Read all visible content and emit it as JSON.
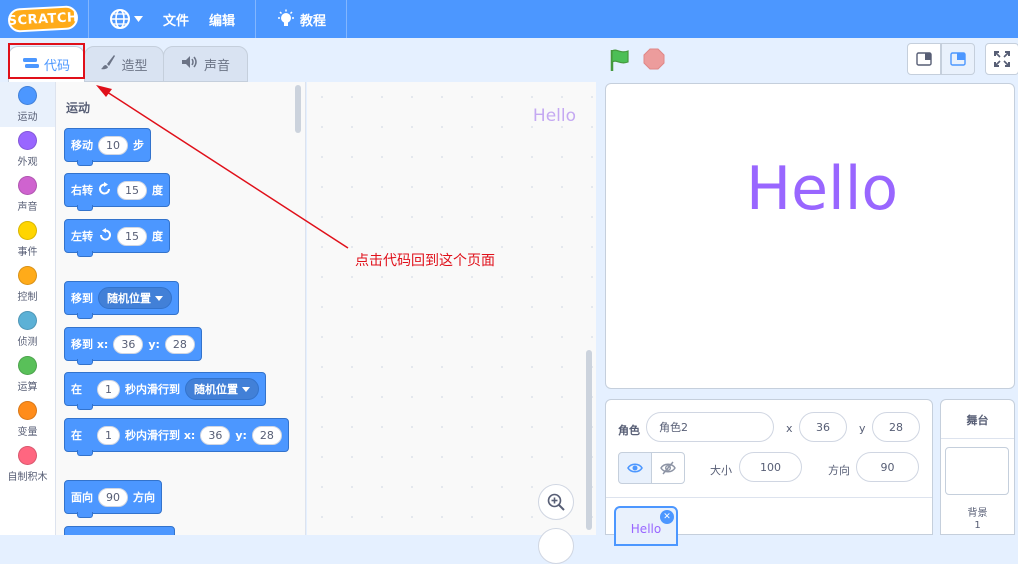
{
  "menubar": {
    "logo": "SCRATCH",
    "file": "文件",
    "edit": "编辑",
    "tutorial": "教程"
  },
  "tabs": {
    "code": "代码",
    "costumes": "造型",
    "sounds": "声音"
  },
  "categories": [
    {
      "label": "运动",
      "color": "#4c97ff"
    },
    {
      "label": "外观",
      "color": "#9966ff"
    },
    {
      "label": "声音",
      "color": "#cf63cf"
    },
    {
      "label": "事件",
      "color": "#ffd500"
    },
    {
      "label": "控制",
      "color": "#ffab19"
    },
    {
      "label": "侦测",
      "color": "#5cb1d6"
    },
    {
      "label": "运算",
      "color": "#59c059"
    },
    {
      "label": "变量",
      "color": "#ff8c1a"
    },
    {
      "label": "自制积木",
      "color": "#ff6680"
    }
  ],
  "palette": {
    "title": "运动",
    "move": {
      "label": "移动",
      "value": "10",
      "suffix": "步"
    },
    "turn_right": {
      "label": "右转",
      "value": "15",
      "suffix": "度"
    },
    "turn_left": {
      "label": "左转",
      "value": "15",
      "suffix": "度"
    },
    "goto": {
      "label": "移到",
      "option": "随机位置"
    },
    "goto_xy": {
      "label": "移到 x:",
      "x": "36",
      "ylabel": "y:",
      "y": "28"
    },
    "glide_random": {
      "prefix": "在",
      "value": "1",
      "middle": "秒内滑行到",
      "option": "随机位置"
    },
    "glide_xy": {
      "prefix": "在",
      "value": "1",
      "middle": "秒内滑行到 x:",
      "x": "36",
      "ylabel": "y:",
      "y": "28"
    },
    "point": {
      "label": "面向",
      "value": "90",
      "suffix": "方向"
    }
  },
  "script_area": {
    "sprite_watermark": "Hello"
  },
  "stage": {
    "text": "Hello"
  },
  "sprite_info": {
    "sprite_label": "角色",
    "sprite_name": "角色2",
    "x_label": "x",
    "x_value": "36",
    "y_label": "y",
    "y_value": "28",
    "size_label": "大小",
    "size_value": "100",
    "direction_label": "方向",
    "direction_value": "90",
    "thumb_label": "Hello"
  },
  "stage_panel": {
    "title": "舞台",
    "backdrop_label": "背景",
    "backdrop_count": "1"
  },
  "annotation": {
    "text": "点击代码回到这个页面",
    "color": "#e0101a"
  }
}
